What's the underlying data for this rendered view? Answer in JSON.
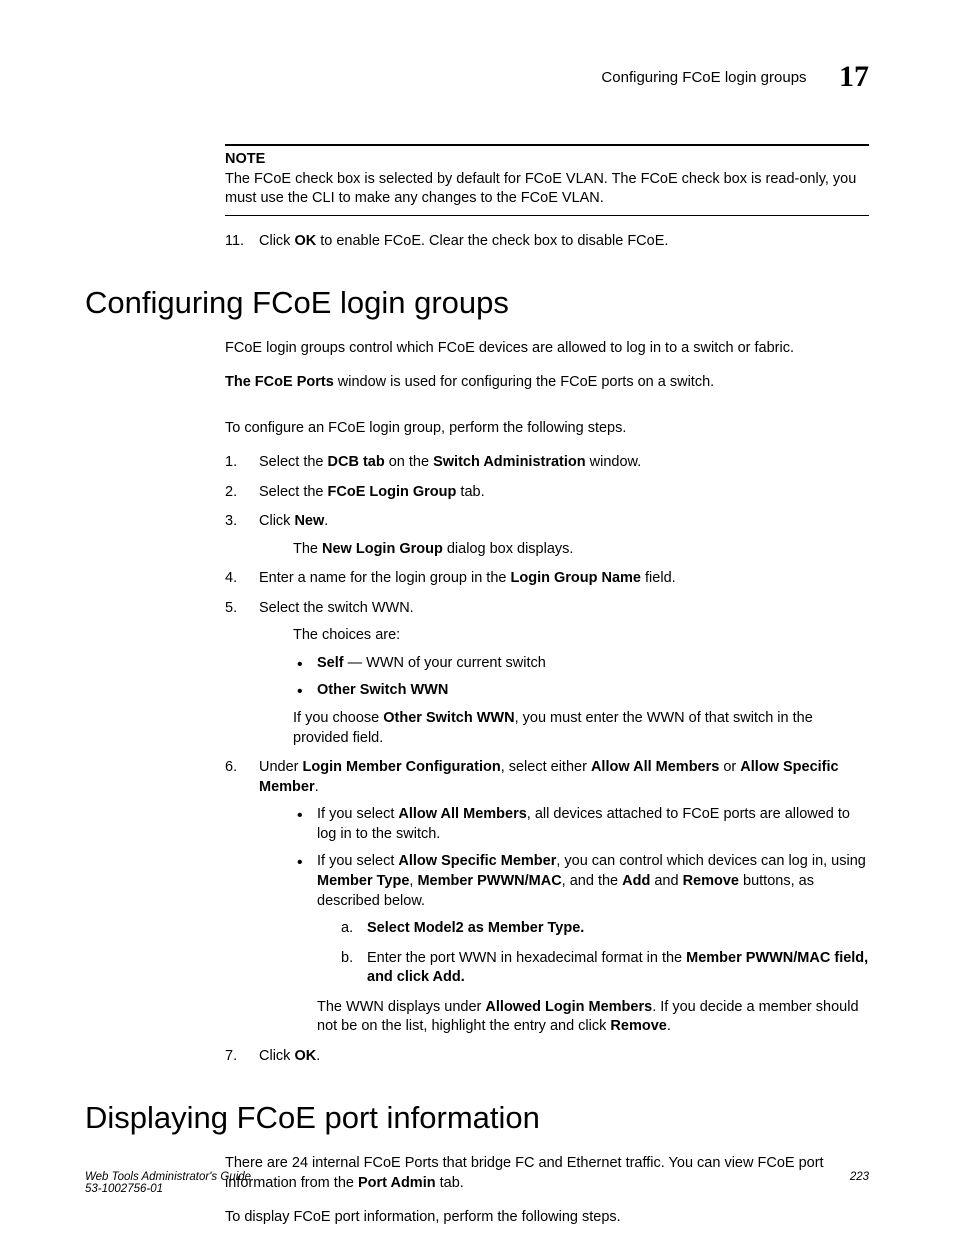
{
  "header": {
    "title": "Configuring FCoE login groups",
    "chapter": "17"
  },
  "note": {
    "label": "NOTE",
    "text": "The FCoE check box is selected by default for FCoE VLAN. The FCoE check box is read-only, you must use the CLI to make any changes to the FCoE VLAN."
  },
  "step11": {
    "num": "11.",
    "pre": "Click ",
    "bold": "OK",
    "post": " to enable FCoE. Clear the check box to disable FCoE."
  },
  "sec1": {
    "heading": "Configuring FCoE login groups",
    "p1": "FCoE login groups control which FCoE devices are allowed to log in to a switch or fabric.",
    "p2a": "The FCoE Ports",
    "p2b": " window is used for configuring the FCoE ports on a switch.",
    "p3": "To configure an FCoE login group, perform the following steps.",
    "s1": {
      "num": "1.",
      "a": "Select the ",
      "b": "DCB tab",
      "c": " on the ",
      "d": "Switch Administration",
      "e": " window."
    },
    "s2": {
      "num": "2.",
      "a": "Select the ",
      "b": "FCoE Login Group",
      "c": " tab."
    },
    "s3": {
      "num": "3.",
      "a": "Click ",
      "b": "New",
      "c": ".",
      "sub_a": "The ",
      "sub_b": "New Login Group",
      "sub_c": " dialog box displays."
    },
    "s4": {
      "num": "4.",
      "a": "Enter a name for the login group in the ",
      "b": "Login Group Name",
      "c": " field."
    },
    "s5": {
      "num": "5.",
      "a": "Select the switch WWN.",
      "choices_intro": "The choices are:",
      "b1a": "Self",
      "b1b": " — WWN of your current switch",
      "b2a": "Other Switch WWN",
      "after_a": "If you choose ",
      "after_b": "Other Switch WWN",
      "after_c": ", you must enter the WWN of that switch in the provided field."
    },
    "s6": {
      "num": "6.",
      "a": "Under ",
      "b": "Login Member Configuration",
      "c": ", select either ",
      "d": "Allow All Members",
      "e": " or ",
      "f": "Allow Specific Member",
      "g": ".",
      "u1a": "If you select ",
      "u1b": "Allow All Members",
      "u1c": ", all devices attached to FCoE ports are allowed to log in to the switch.",
      "u2a": "If you select ",
      "u2b": "Allow Specific Member",
      "u2c": ", you can control which devices can log in, using ",
      "u2d": "Member Type",
      "u2e": ", ",
      "u2f": "Member PWWN/MAC",
      "u2g": ", and the ",
      "u2h": "Add",
      "u2i": " and ",
      "u2j": "Remove",
      "u2k": " buttons, as described below.",
      "a1": {
        "al": "a.",
        "text": "Select Model2 as Member Type."
      },
      "a2": {
        "al": "b.",
        "pre": "Enter the port WWN in hexadecimal format in the ",
        "bold": "Member PWWN/MAC field, and click Add."
      },
      "u2_after_a": "The WWN displays under ",
      "u2_after_b": "Allowed Login Members",
      "u2_after_c": ". If you decide a member should not be on the list, highlight the entry and click ",
      "u2_after_d": "Remove",
      "u2_after_e": "."
    },
    "s7": {
      "num": "7.",
      "a": "Click ",
      "b": "OK",
      "c": "."
    }
  },
  "sec2": {
    "heading": "Displaying FCoE port information",
    "p1a": "There are 24 internal FCoE Ports that bridge FC and Ethernet traffic. You can view FCoE port information from the ",
    "p1b": "Port Admin",
    "p1c": " tab.",
    "p2": "To display FCoE port information, perform the following steps."
  },
  "footer": {
    "line1": "Web Tools Administrator's Guide",
    "line2": "53-1002756-01",
    "page": "223"
  }
}
